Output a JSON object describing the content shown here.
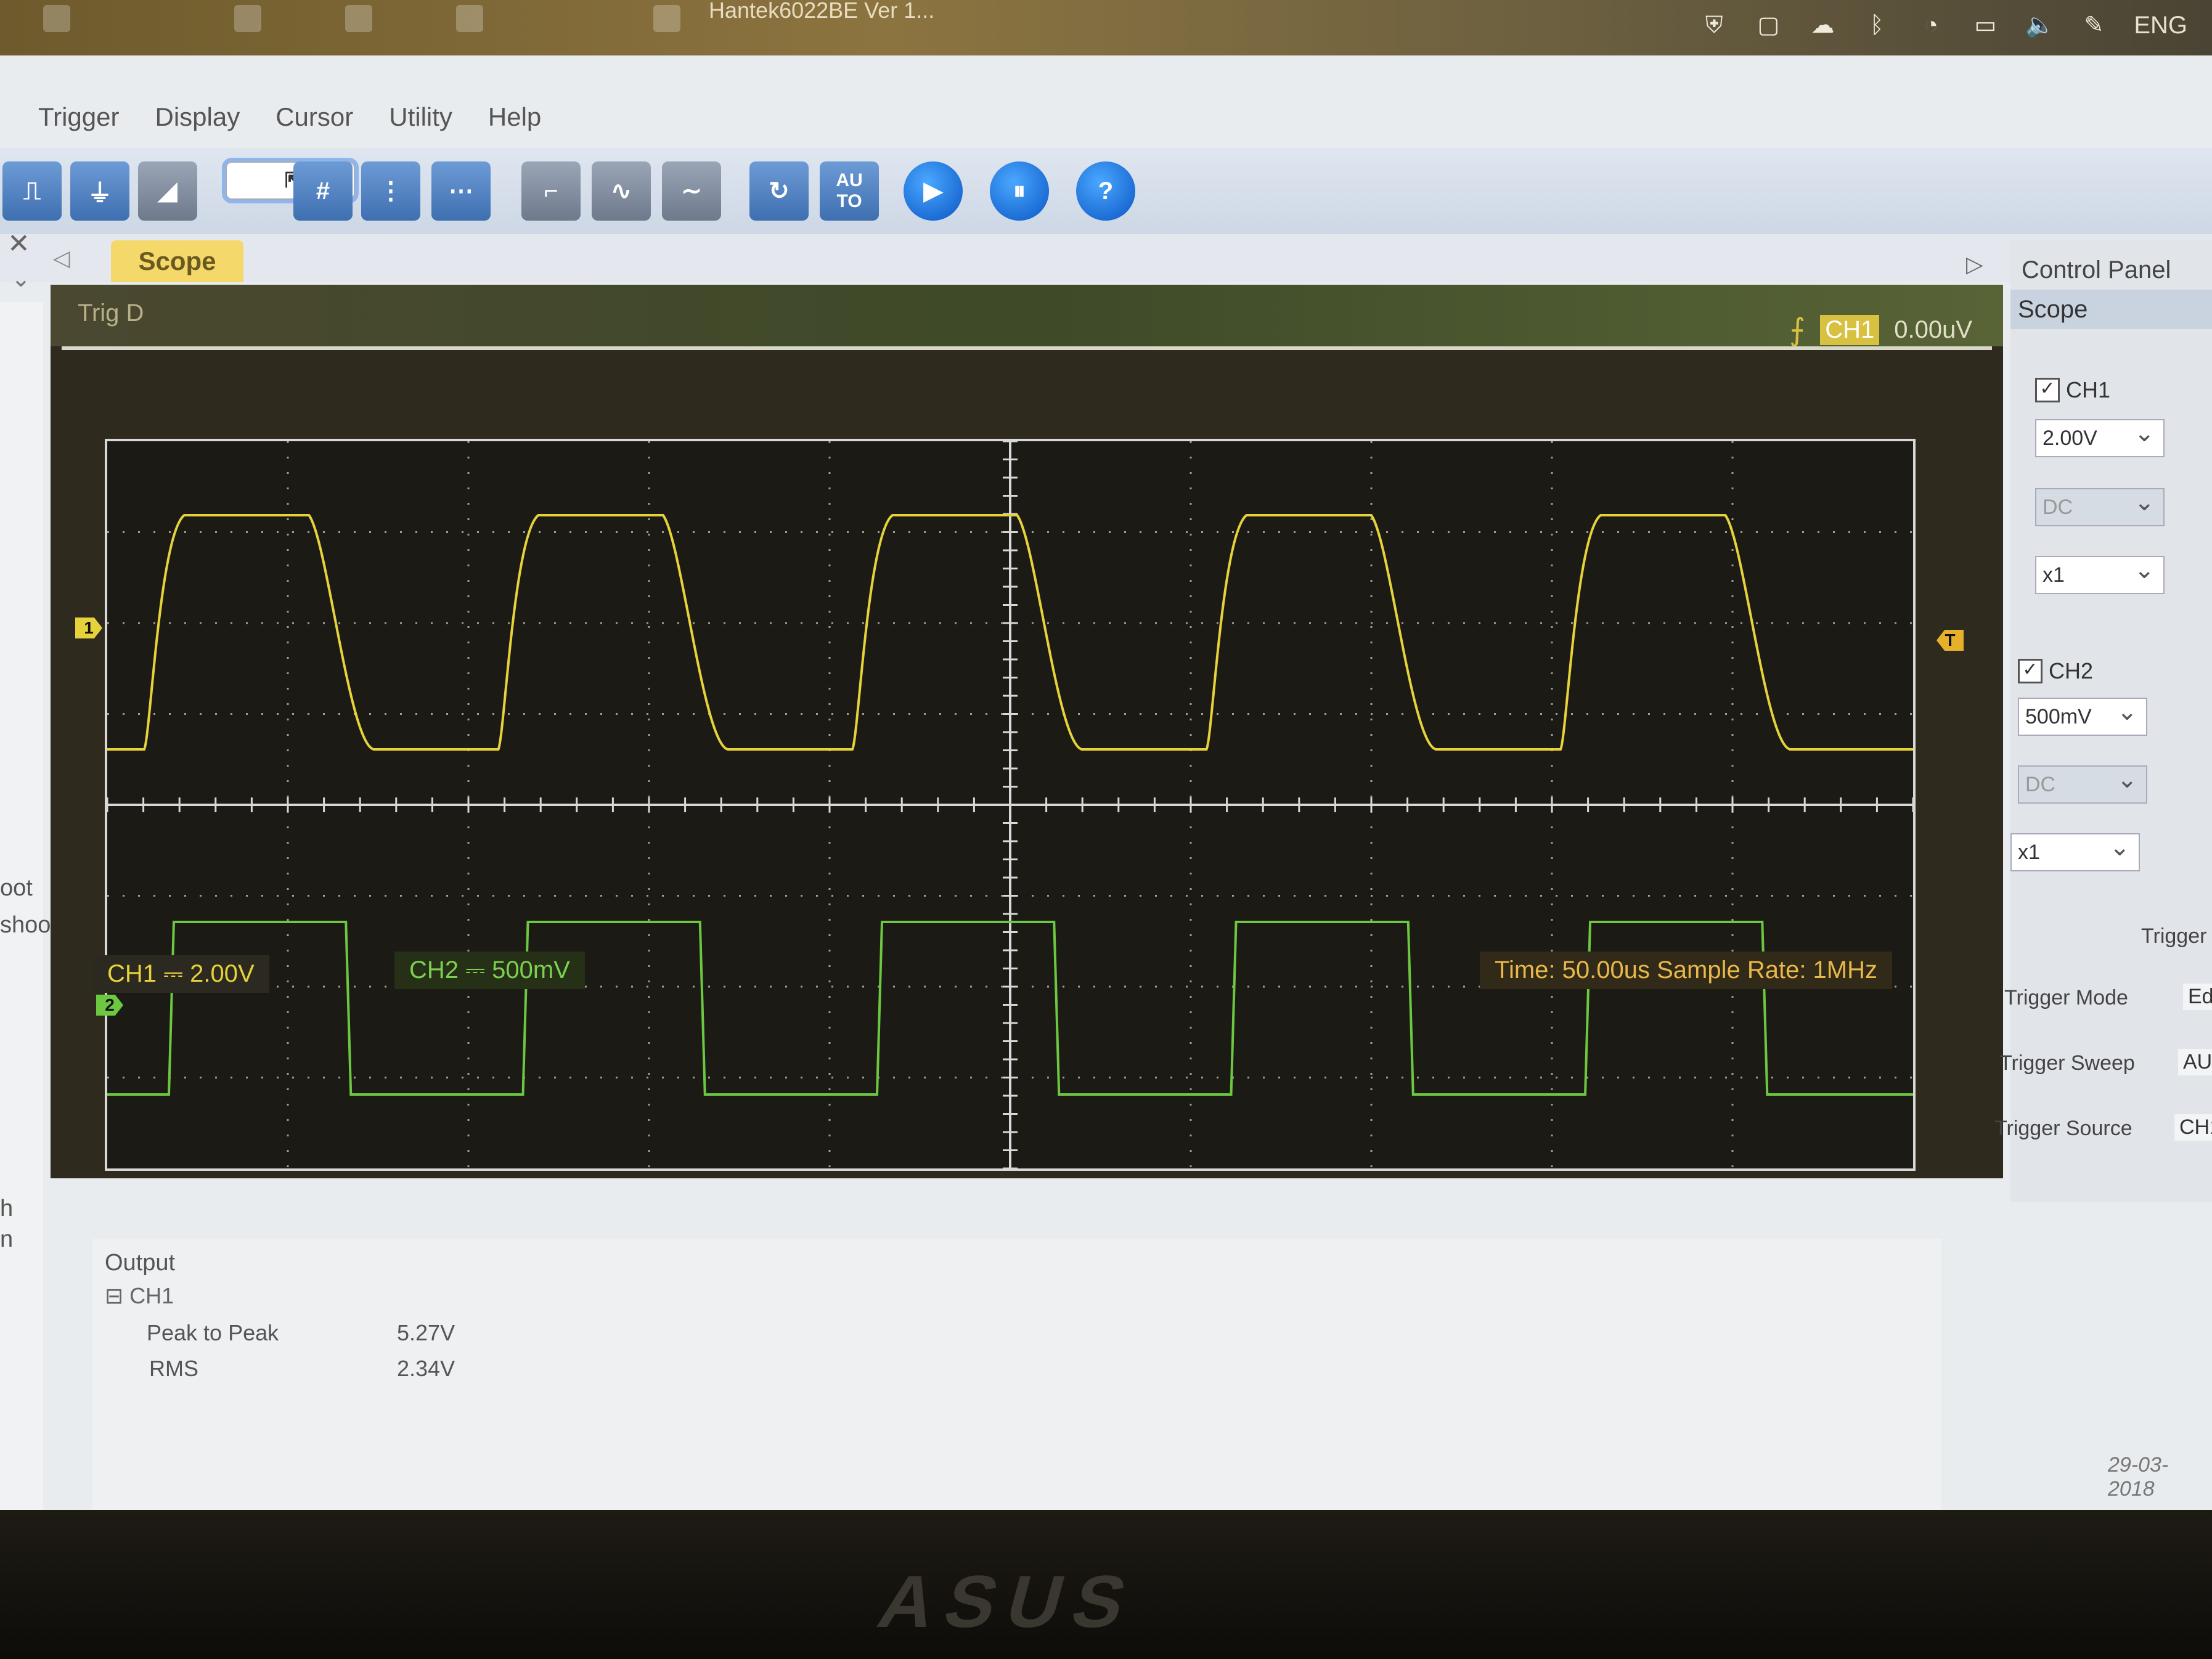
{
  "taskbar": {
    "app_title": "Hantek6022BE Ver 1...",
    "lang": "ENG"
  },
  "menu": {
    "items": [
      "Trigger",
      "Display",
      "Cursor",
      "Utility",
      "Help"
    ]
  },
  "toolbar": {
    "auto_label": "AU\nTO",
    "help_label": "?"
  },
  "tabs": {
    "scope_label": "Scope"
  },
  "left_strip": {
    "items": [
      "oot",
      "shoot",
      "h",
      "n"
    ]
  },
  "scope": {
    "trig_status": "Trig D",
    "trigger_channel": "CH1",
    "trigger_level": "0.00uV",
    "ch1_marker": "1",
    "ch2_marker": "2",
    "trigger_marker": "T",
    "colors": {
      "ch1": "#e6d23a",
      "ch2": "#6cc840",
      "grid": "#d8d8d8",
      "background": "#1c1a14"
    }
  },
  "status": {
    "ch1_label": "CH1 ⎓ 2.00V",
    "ch2_label": "CH2 ⎓ 500mV",
    "time_rate": "Time: 50.00us    Sample Rate: 1MHz"
  },
  "control_panel": {
    "title": "Control Panel",
    "section": "Scope",
    "ch1_name": "CH1",
    "ch1_volts": "2.00V",
    "ch1_coupling": "DC",
    "ch1_probe": "x1",
    "ch2_name": "CH2",
    "ch2_volts": "500mV",
    "ch2_coupling": "DC",
    "ch2_probe": "x1",
    "trigger_heading": "Trigger",
    "trigger_mode_label": "Trigger Mode",
    "trigger_mode_value": "Ed",
    "trigger_sweep_label": "Trigger Sweep",
    "trigger_sweep_value": "AU",
    "trigger_source_label": "Trigger Source",
    "trigger_source_value": "CH1"
  },
  "output": {
    "heading": "Output",
    "channel": "CH1",
    "rows": [
      {
        "label": "Peak to Peak",
        "value": "5.27V"
      },
      {
        "label": "RMS",
        "value": "2.34V"
      }
    ]
  },
  "footer": {
    "date": "29-03-2018"
  }
}
